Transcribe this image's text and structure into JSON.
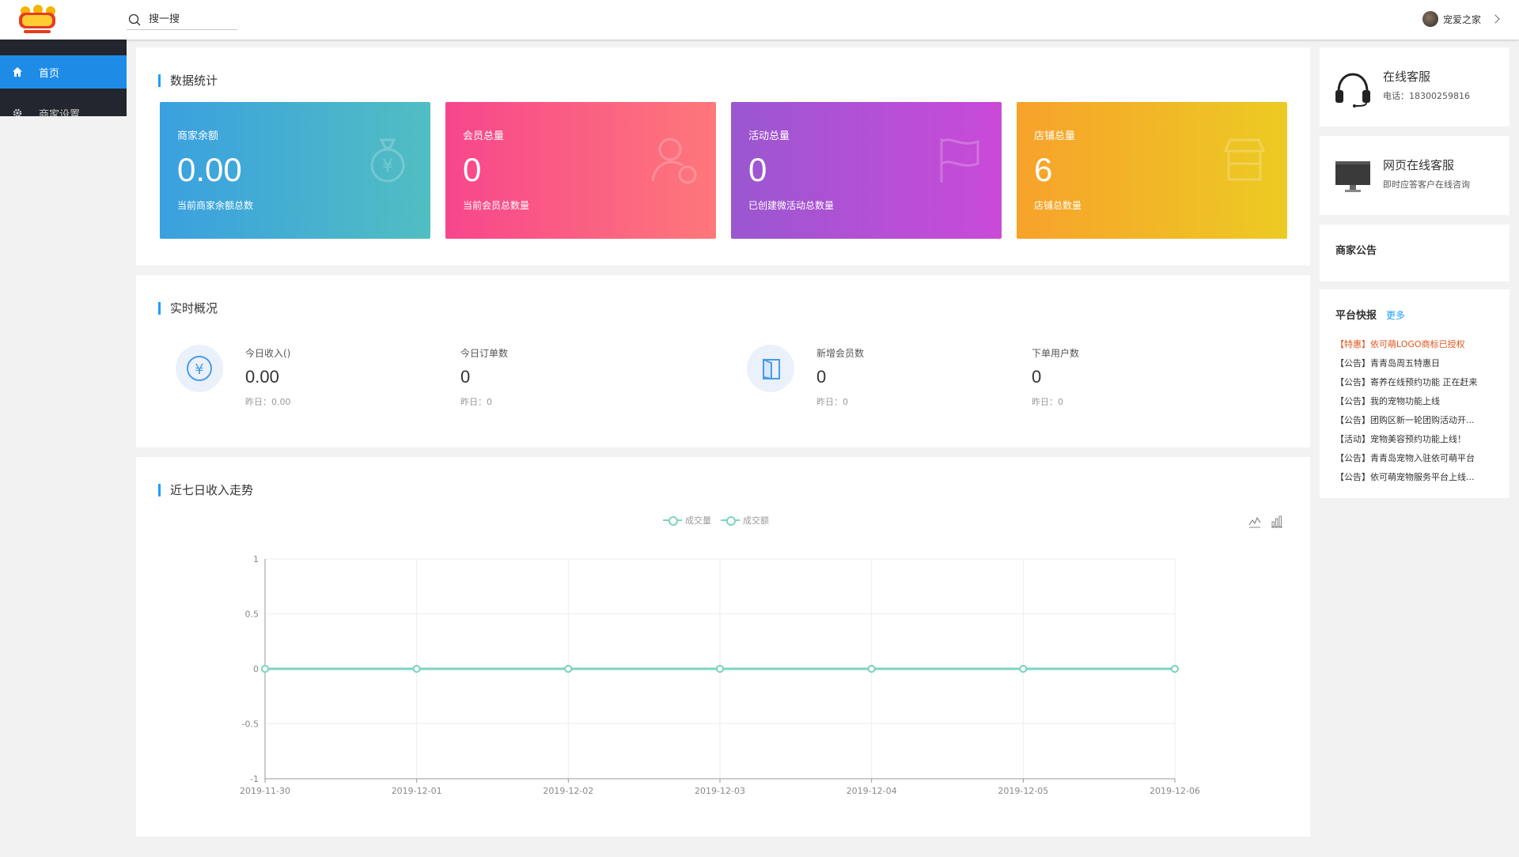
{
  "header": {
    "logo_alt": "依可萌",
    "search_placeholder": "搜一搜",
    "user_name": "宠爱之家"
  },
  "sidebar": {
    "items": [
      {
        "label": "首页",
        "icon": "home-icon",
        "active": true
      },
      {
        "label": "商家设置",
        "icon": "gear-icon",
        "active": false
      }
    ]
  },
  "stats": {
    "title": "数据统计",
    "cards": [
      {
        "label": "商家余额",
        "value": "0.00",
        "sub": "当前商家余额总数",
        "icon": "money-bag-icon",
        "color_from": "#3aa0e0",
        "color_to": "#51bec1"
      },
      {
        "label": "会员总量",
        "value": "0",
        "sub": "当前会员总数量",
        "icon": "member-icon",
        "color_from": "#f7468c",
        "color_to": "#fe787a"
      },
      {
        "label": "活动总量",
        "value": "0",
        "sub": "已创建微活动总数量",
        "icon": "flag-icon",
        "color_from": "#9a57d0",
        "color_to": "#ca4ad7"
      },
      {
        "label": "店铺总量",
        "value": "6",
        "sub": "店铺总数量",
        "icon": "shop-icon",
        "color_from": "#f7a22b",
        "color_to": "#eccb23"
      }
    ]
  },
  "overview": {
    "title": "实时概况",
    "items": [
      {
        "label": "今日收入()",
        "value": "0.00",
        "sub": "昨日：0.00"
      },
      {
        "label": "今日订单数",
        "value": "0",
        "sub": "昨日：0"
      },
      {
        "label": "新增会员数",
        "value": "0",
        "sub": "昨日：0"
      },
      {
        "label": "下单用户数",
        "value": "0",
        "sub": "昨日：0"
      }
    ]
  },
  "trend": {
    "title": "近七日收入走势",
    "legend": [
      "成交量",
      "成交额"
    ]
  },
  "chart_data": {
    "type": "line",
    "title": "近七日收入走势",
    "x": [
      "2019-11-30",
      "2019-12-01",
      "2019-12-02",
      "2019-12-03",
      "2019-12-04",
      "2019-12-05",
      "2019-12-06"
    ],
    "series": [
      {
        "name": "成交量",
        "values": [
          0,
          0,
          0,
          0,
          0,
          0,
          0
        ]
      },
      {
        "name": "成交额",
        "values": [
          0,
          0,
          0,
          0,
          0,
          0,
          0
        ]
      }
    ],
    "yticks": [
      "1",
      "0.5",
      "0",
      "-0.5",
      "-1"
    ],
    "ylim": [
      -1,
      1
    ],
    "grid": true,
    "legend_position": "top-center",
    "line_color": "#7ed3c0"
  },
  "service": {
    "online_title": "在线客服",
    "online_phone": "电话：18300259816",
    "web_title": "网页在线客服",
    "web_sub": "即时应答客户在线咨询"
  },
  "notice": {
    "title": "商家公告"
  },
  "news": {
    "title": "平台快报",
    "more": "更多",
    "items": [
      {
        "text": "【特惠】依可萌LOGO商标已授权",
        "hot": true
      },
      {
        "text": "【公告】青青岛周五特惠日",
        "hot": false
      },
      {
        "text": "【公告】寄养在线预约功能 正在赶来",
        "hot": false
      },
      {
        "text": "【公告】我的宠物功能上线",
        "hot": false
      },
      {
        "text": "【公告】团购区新一轮团购活动开...",
        "hot": false
      },
      {
        "text": "【活动】宠物美容预约功能上线！",
        "hot": false
      },
      {
        "text": "【公告】青青岛宠物入驻依可萌平台",
        "hot": false
      },
      {
        "text": "【公告】依可萌宠物服务平台上线...",
        "hot": false
      }
    ]
  }
}
